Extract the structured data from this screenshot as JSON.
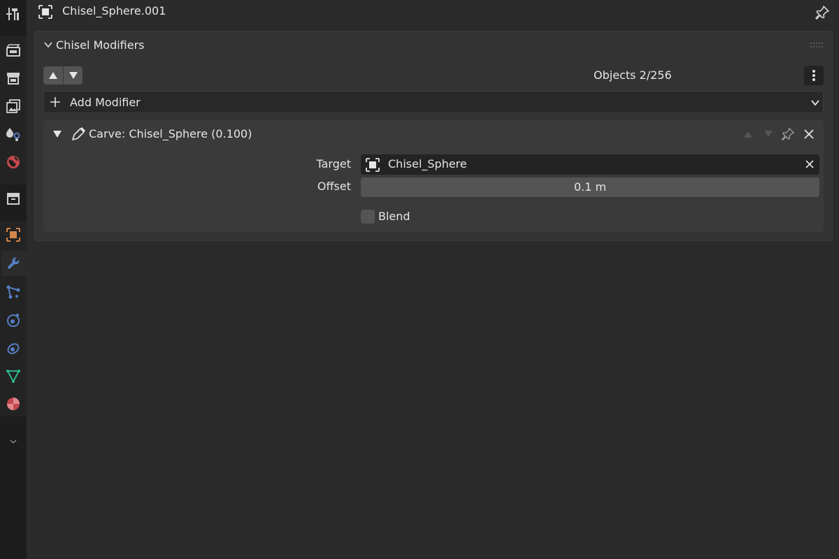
{
  "header": {
    "object_name": "Chisel_Sphere.001",
    "object_icon": "object-data-icon",
    "pin_icon": "pin-icon"
  },
  "tabs": [
    {
      "name": "tool",
      "icon": "tool-icon",
      "active": false
    },
    {
      "name": "render",
      "icon": "render-icon",
      "active": false
    },
    {
      "name": "output",
      "icon": "output-icon",
      "active": false
    },
    {
      "name": "view-layer",
      "icon": "view-layer-icon",
      "active": false
    },
    {
      "name": "scene",
      "icon": "scene-icon",
      "active": false
    },
    {
      "name": "world",
      "icon": "world-icon",
      "active": false
    },
    {
      "name": "collection",
      "icon": "collection-icon",
      "active": false
    },
    {
      "name": "object",
      "icon": "object-icon",
      "active": false
    },
    {
      "name": "modifiers",
      "icon": "wrench-icon",
      "active": true
    },
    {
      "name": "particles",
      "icon": "particles-icon",
      "active": false
    },
    {
      "name": "physics",
      "icon": "physics-icon",
      "active": false
    },
    {
      "name": "constraints",
      "icon": "constraints-icon",
      "active": false
    },
    {
      "name": "data",
      "icon": "mesh-data-icon",
      "active": false
    },
    {
      "name": "material",
      "icon": "material-icon",
      "active": false
    }
  ],
  "panel": {
    "title": "Chisel Modifiers",
    "objects_count": "Objects 2/256",
    "add_modifier_label": "Add Modifier"
  },
  "modifier": {
    "name": "Carve: Chisel_Sphere (0.100)",
    "target_label": "Target",
    "target_value": "Chisel_Sphere",
    "offset_label": "Offset",
    "offset_value": "0.1 m",
    "blend_label": "Blend",
    "blend_checked": false
  },
  "colors": {
    "accent_blue": "#5680c2",
    "object_orange": "#d4864c",
    "world_red": "#c2484d",
    "mesh_green": "#2fb58e"
  }
}
